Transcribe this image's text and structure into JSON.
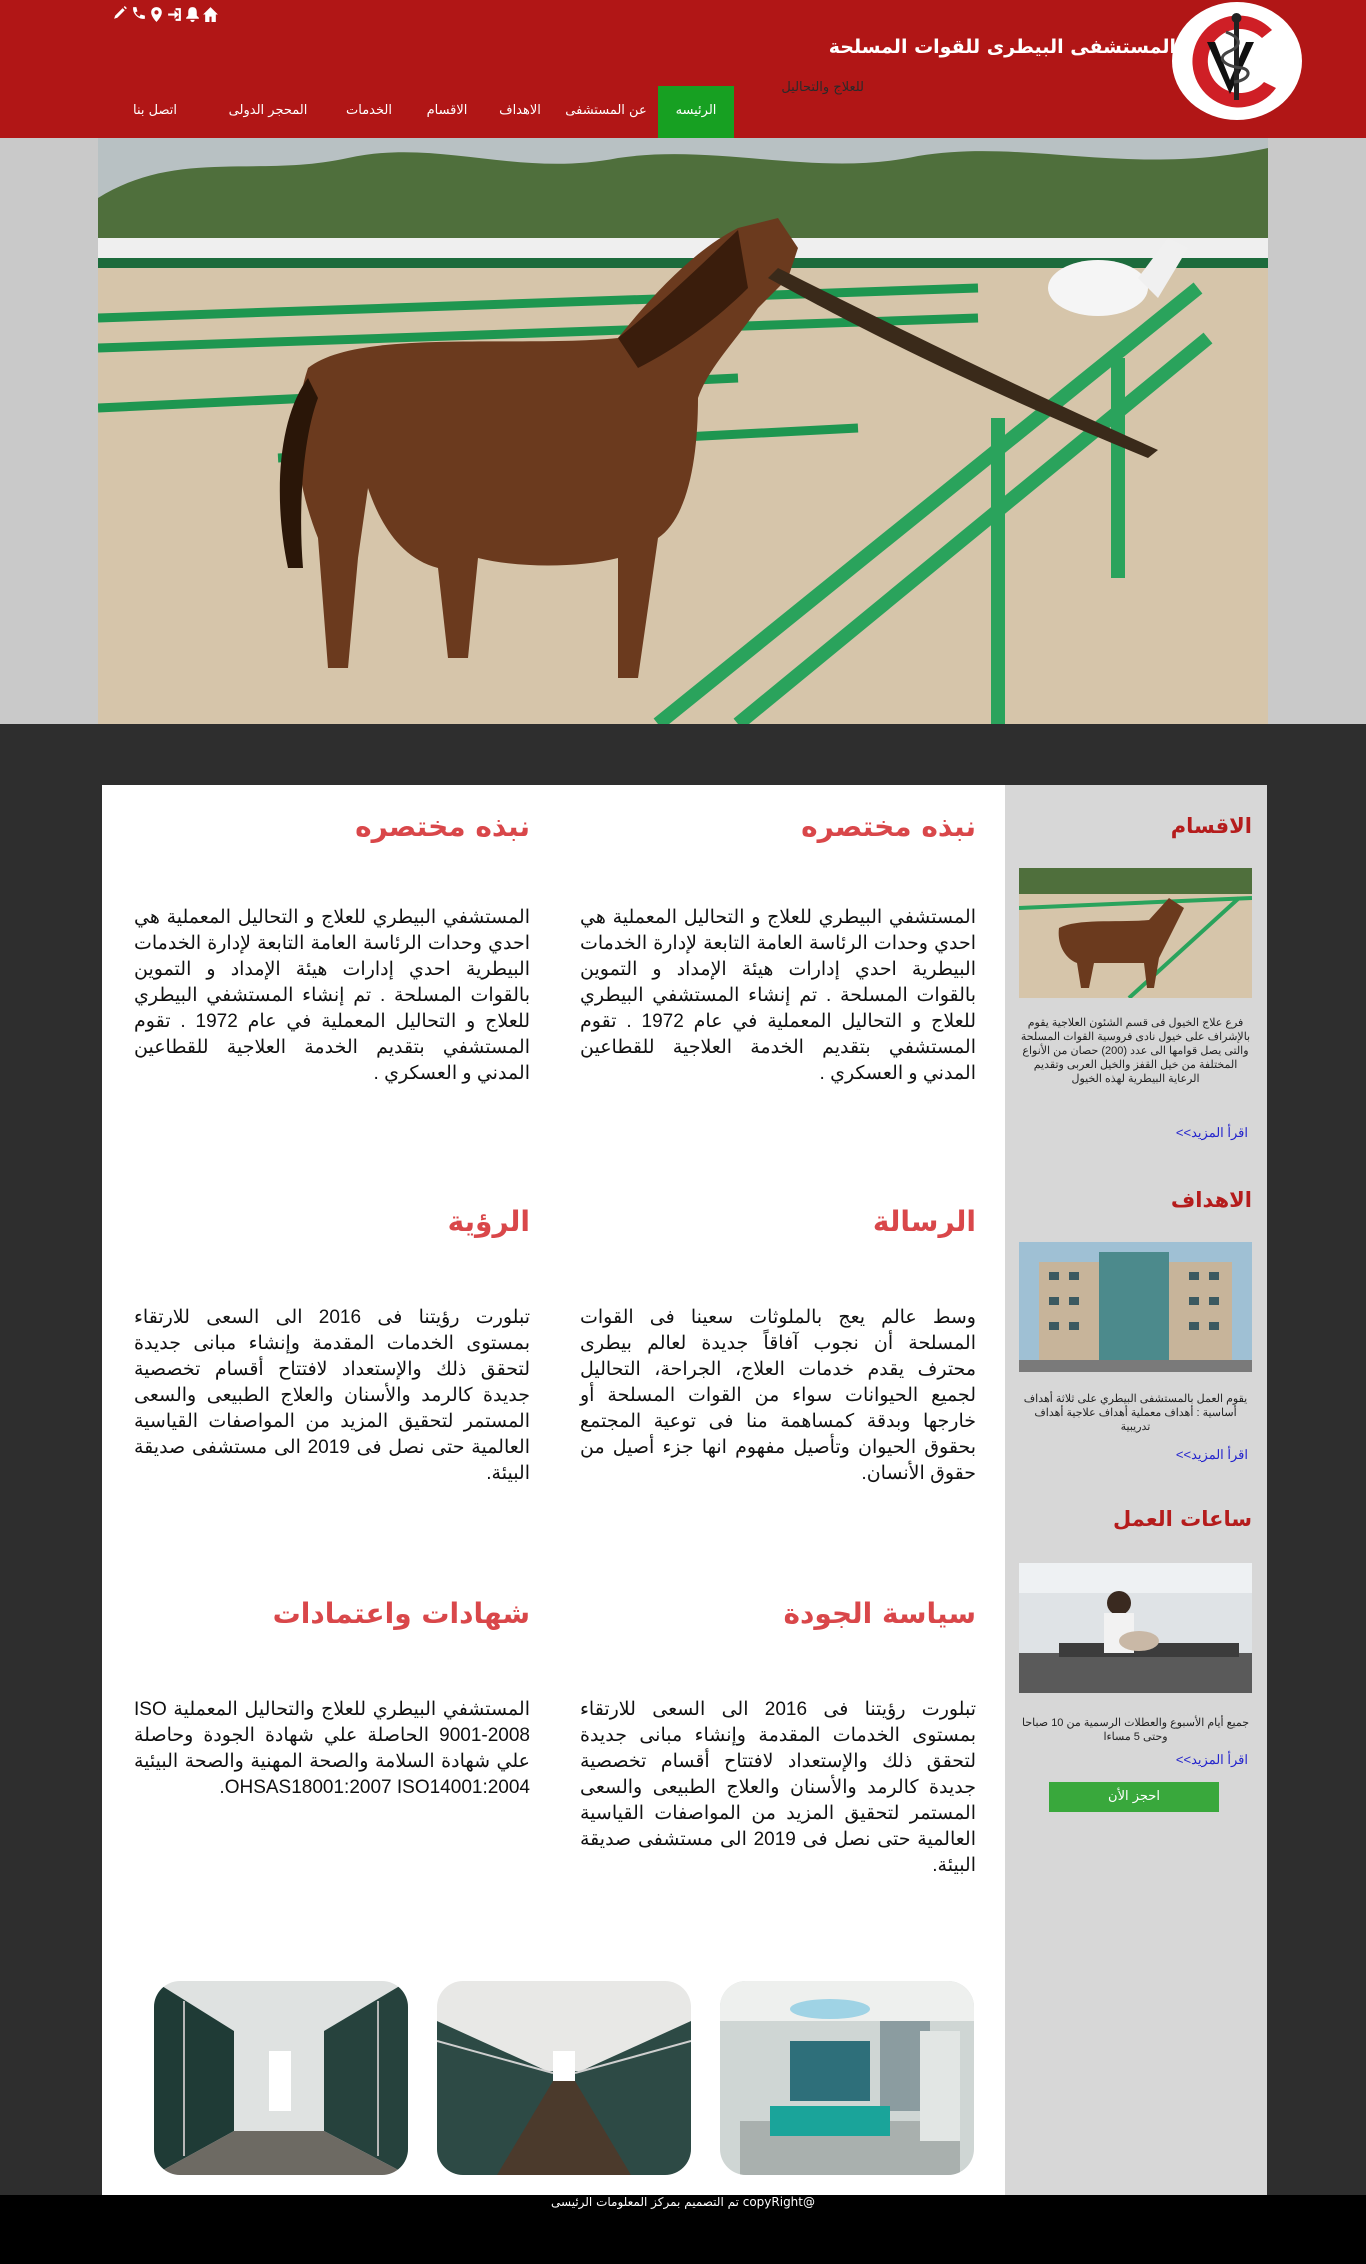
{
  "header": {
    "site_title": "المستشفى البيطرى للقوات المسلحة",
    "subtitle": "للعلاج والتحاليل",
    "logo_icon": "veterinary-caduceus-logo",
    "top_icons": [
      "edit-icon",
      "phone-icon",
      "location-icon",
      "login-icon",
      "bell-icon",
      "home-icon"
    ]
  },
  "nav": {
    "items": [
      {
        "label": "الرئيسه"
      },
      {
        "label": "عن المستشفى"
      },
      {
        "label": "الاهداف"
      },
      {
        "label": "الاقسام"
      },
      {
        "label": "الخدمات"
      },
      {
        "label": "المحجر الدولى"
      },
      {
        "label": "اتصل بنا"
      }
    ],
    "active_index": 0
  },
  "main": {
    "sections": [
      {
        "title": "نبذه مختصره",
        "text": "المستشفي البيطري للعلاج و التحاليل المعملية هي احدي وحدات الرئاسة العامة التابعة لإدارة الخدمات البيطرية احدي إدارات هيئة الإمداد و التموين بالقوات المسلحة . تم إنشاء المستشفي البيطري للعلاج و التحاليل المعملية في عام 1972 . تقوم المستشفي بتقديم الخدمة العلاجية للقطاعين المدني و العسكري ."
      },
      {
        "title": "نبذه مختصره",
        "text": "المستشفي البيطري للعلاج و التحاليل المعملية هي احدي وحدات الرئاسة العامة التابعة لإدارة الخدمات البيطرية احدي إدارات هيئة الإمداد و التموين بالقوات المسلحة . تم إنشاء المستشفي البيطري للعلاج و التحاليل المعملية في عام 1972 . تقوم المستشفي بتقديم الخدمة العلاجية للقطاعين المدني و العسكري ."
      },
      {
        "title": "الرسالة",
        "text": "وسط عالم يعج بالملوثات سعينا فى القوات المسلحة أن نجوب آفاقاً جديدة لعالم بيطرى محترف يقدم خدمات العلاج، الجراحة، التحاليل لجميع الحيوانات سواء من القوات المسلحة أو خارجها وبدقة كمساهمة منا فى توعية المجتمع بحقوق الحيوان وتأصيل مفهوم انها جزء أصيل من حقوق الأنسان."
      },
      {
        "title": "الرؤية",
        "text": "تبلورت رؤيتنا فى 2016 الى السعى للارتقاء بمستوى الخدمات المقدمة وإنشاء مبانى جديدة لتحقق ذلك والإستعداد لافتتاح أقسام تخصصية جديدة كالرمد والأسنان والعلاج الطبيعى والسعى المستمر لتحقيق المزيد من المواصفات القياسية العالمية حتى نصل فى 2019 الى مستشفى صديقة البيئة."
      },
      {
        "title": "سياسة الجودة",
        "text": "تبلورت رؤيتنا فى 2016 الى السعى للارتقاء بمستوى الخدمات المقدمة وإنشاء مبانى جديدة لتحقق ذلك والإستعداد لافتتاح أقسام تخصصية جديدة كالرمد والأسنان والعلاج الطبيعى والسعى المستمر لتحقيق المزيد من المواصفات القياسية العالمية حتى نصل فى 2019 الى مستشفى صديقة البيئة."
      },
      {
        "title": "شهادات واعتمادات",
        "text": "المستشفي البيطري للعلاج والتحاليل المعملية ISO 9001-2008 الحاصلة علي شهادة الجودة وحاصلة علي شهادة السلامة والصحة المهنية والصحة البيئية OHSAS18001:2007 ISO14001:2004."
      }
    ]
  },
  "sidebar": {
    "sections": [
      {
        "title": "الاقسام",
        "text": "فرع علاج الخيول فى قسم الشئون العلاجية يقوم بالإشراف على خيول نادى فروسية القوات المسلحة والتى يصل قوامها الى عدد (200) حصان من الأنواع المختلفة من خيل القفز والخيل العربى وتقديم الرعاية البيطرية لهذه الخيول",
        "link": "اقرأ المزيد>>"
      },
      {
        "title": "الاهداف",
        "text": "يقوم العمل بالمستشفى البيطري على ثلاثة أهداف أساسية : أهداف معملية أهداف علاجية أهداف تدريبية",
        "link": "اقرأ المزيد>>"
      },
      {
        "title": "ساعات العمل",
        "text": "جميع أيام الأسبوع والعطلات الرسمية من 10 صباحا وحتى 5 مساءا",
        "link": "اقرأ المزيد>>"
      }
    ],
    "book_button": "احجز الأن"
  },
  "footer": {
    "text": "@copyRight تم التصميم بمركز المعلومات الرئيسى"
  }
}
